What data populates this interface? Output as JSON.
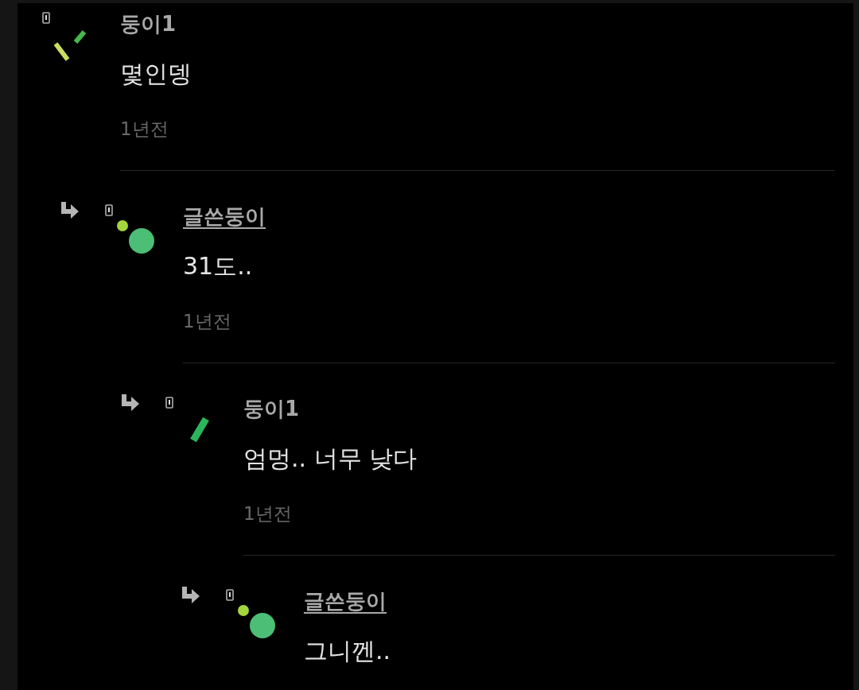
{
  "comments": [
    {
      "name": "둥이1",
      "author": false,
      "avatar": {
        "kind": "two-bars"
      },
      "text": "몇인뎅",
      "time": "1년전",
      "children": [
        {
          "name": "글쓴둥이",
          "author": true,
          "avatar": {
            "kind": "dots"
          },
          "text": "31도..",
          "time": "1년전",
          "children": [
            {
              "name": "둥이1",
              "author": false,
              "avatar": {
                "kind": "one-bar"
              },
              "text": "엄멍.. 너무 낮다",
              "time": "1년전",
              "children": [
                {
                  "name": "글쓴둥이",
                  "author": true,
                  "avatar": {
                    "kind": "dots"
                  },
                  "text": "그니껜.."
                }
              ]
            }
          ]
        }
      ]
    }
  ]
}
